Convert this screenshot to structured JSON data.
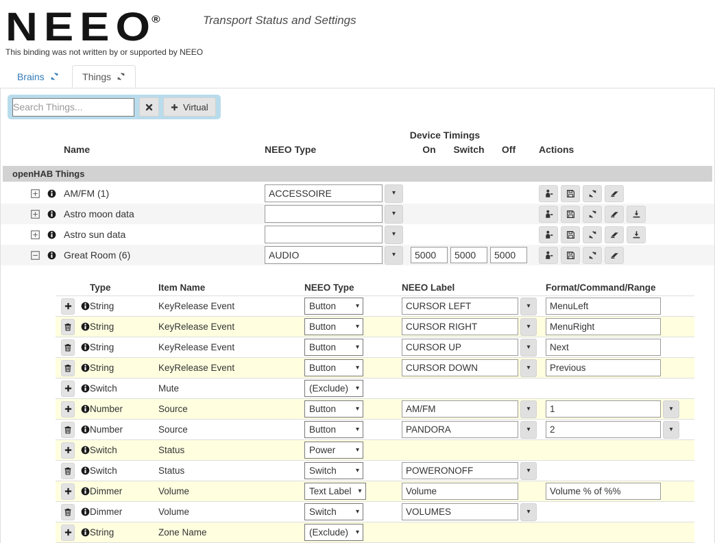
{
  "header": {
    "logo": "NEEO",
    "registered": "®",
    "subtitle": "Transport Status and Settings",
    "disclaimer": "This binding was not written by or supported by NEEO"
  },
  "tabs": [
    {
      "label": "Brains",
      "icon": "refresh-icon",
      "active": false
    },
    {
      "label": "Things",
      "icon": "refresh-icon",
      "active": true
    }
  ],
  "search": {
    "placeholder": "Search Things...",
    "value": "",
    "clear_icon": "x-icon",
    "virtual_button": {
      "icon": "plus-icon",
      "label": "Virtual"
    }
  },
  "things_table": {
    "group_header": "Device Timings",
    "columns": {
      "name": "Name",
      "neeo_type": "NEEO Type",
      "on": "On",
      "switch": "Switch",
      "off": "Off",
      "actions": "Actions"
    },
    "section_header": "openHAB Things",
    "rows": [
      {
        "expanded": false,
        "name": "AM/FM (1)",
        "neeo_type": "ACCESSOIRE",
        "timings": null,
        "actions": [
          "transfer",
          "save",
          "refresh",
          "erase"
        ]
      },
      {
        "expanded": false,
        "name": "Astro moon data",
        "neeo_type": "",
        "timings": null,
        "actions": [
          "transfer",
          "save",
          "refresh",
          "erase",
          "download"
        ]
      },
      {
        "expanded": false,
        "name": "Astro sun data",
        "neeo_type": "",
        "timings": null,
        "actions": [
          "transfer",
          "save",
          "refresh",
          "erase",
          "download"
        ]
      },
      {
        "expanded": true,
        "name": "Great Room (6)",
        "neeo_type": "AUDIO",
        "timings": {
          "on": "5000",
          "switch": "5000",
          "off": "5000"
        },
        "actions": [
          "transfer",
          "save",
          "refresh",
          "erase"
        ]
      }
    ]
  },
  "channels_table": {
    "columns": {
      "type": "Type",
      "item_name": "Item Name",
      "neeo_type": "NEEO Type",
      "neeo_label": "NEEO Label",
      "format": "Format/Command/Range"
    },
    "rows": [
      {
        "action": "add",
        "type": "String",
        "item_name": "KeyRelease Event",
        "neeo_type": "Button",
        "neeo_label": "CURSOR LEFT",
        "label_dropdown": true,
        "format": "MenuLeft",
        "format_dropdown": false
      },
      {
        "action": "delete",
        "type": "String",
        "item_name": "KeyRelease Event",
        "neeo_type": "Button",
        "neeo_label": "CURSOR RIGHT",
        "label_dropdown": true,
        "format": "MenuRight",
        "format_dropdown": false
      },
      {
        "action": "delete",
        "type": "String",
        "item_name": "KeyRelease Event",
        "neeo_type": "Button",
        "neeo_label": "CURSOR UP",
        "label_dropdown": true,
        "format": "Next",
        "format_dropdown": false
      },
      {
        "action": "delete",
        "type": "String",
        "item_name": "KeyRelease Event",
        "neeo_type": "Button",
        "neeo_label": "CURSOR DOWN",
        "label_dropdown": true,
        "format": "Previous",
        "format_dropdown": false
      },
      {
        "action": "add",
        "type": "Switch",
        "item_name": "Mute",
        "neeo_type": "(Exclude)",
        "neeo_label": null,
        "label_dropdown": false,
        "format": null,
        "format_dropdown": false
      },
      {
        "action": "add",
        "type": "Number",
        "item_name": "Source",
        "neeo_type": "Button",
        "neeo_label": "AM/FM",
        "label_dropdown": true,
        "format": "1",
        "format_dropdown": true
      },
      {
        "action": "delete",
        "type": "Number",
        "item_name": "Source",
        "neeo_type": "Button",
        "neeo_label": "PANDORA",
        "label_dropdown": true,
        "format": "2",
        "format_dropdown": true
      },
      {
        "action": "add",
        "type": "Switch",
        "item_name": "Status",
        "neeo_type": "Power",
        "neeo_label": null,
        "label_dropdown": false,
        "format": null,
        "format_dropdown": false
      },
      {
        "action": "delete",
        "type": "Switch",
        "item_name": "Status",
        "neeo_type": "Switch",
        "neeo_label": "POWERONOFF",
        "label_dropdown": true,
        "format": null,
        "format_dropdown": false
      },
      {
        "action": "add",
        "type": "Dimmer",
        "item_name": "Volume",
        "neeo_type": "Text Label",
        "neeo_label": "Volume",
        "label_dropdown": false,
        "format": "Volume % of %%",
        "format_dropdown": false
      },
      {
        "action": "delete",
        "type": "Dimmer",
        "item_name": "Volume",
        "neeo_type": "Switch",
        "neeo_label": "VOLUMES",
        "label_dropdown": true,
        "format": null,
        "format_dropdown": false
      },
      {
        "action": "add",
        "type": "String",
        "item_name": "Zone Name",
        "neeo_type": "(Exclude)",
        "neeo_label": null,
        "label_dropdown": false,
        "format": null,
        "format_dropdown": false
      }
    ]
  },
  "colors": {
    "accent_blue": "#337ab7",
    "search_bar_bg": "#b9dcec",
    "section_header_bg": "#d2d2d2",
    "row_stripe": "#f5f5f5",
    "channel_row_highlight": "#ffffe0"
  }
}
